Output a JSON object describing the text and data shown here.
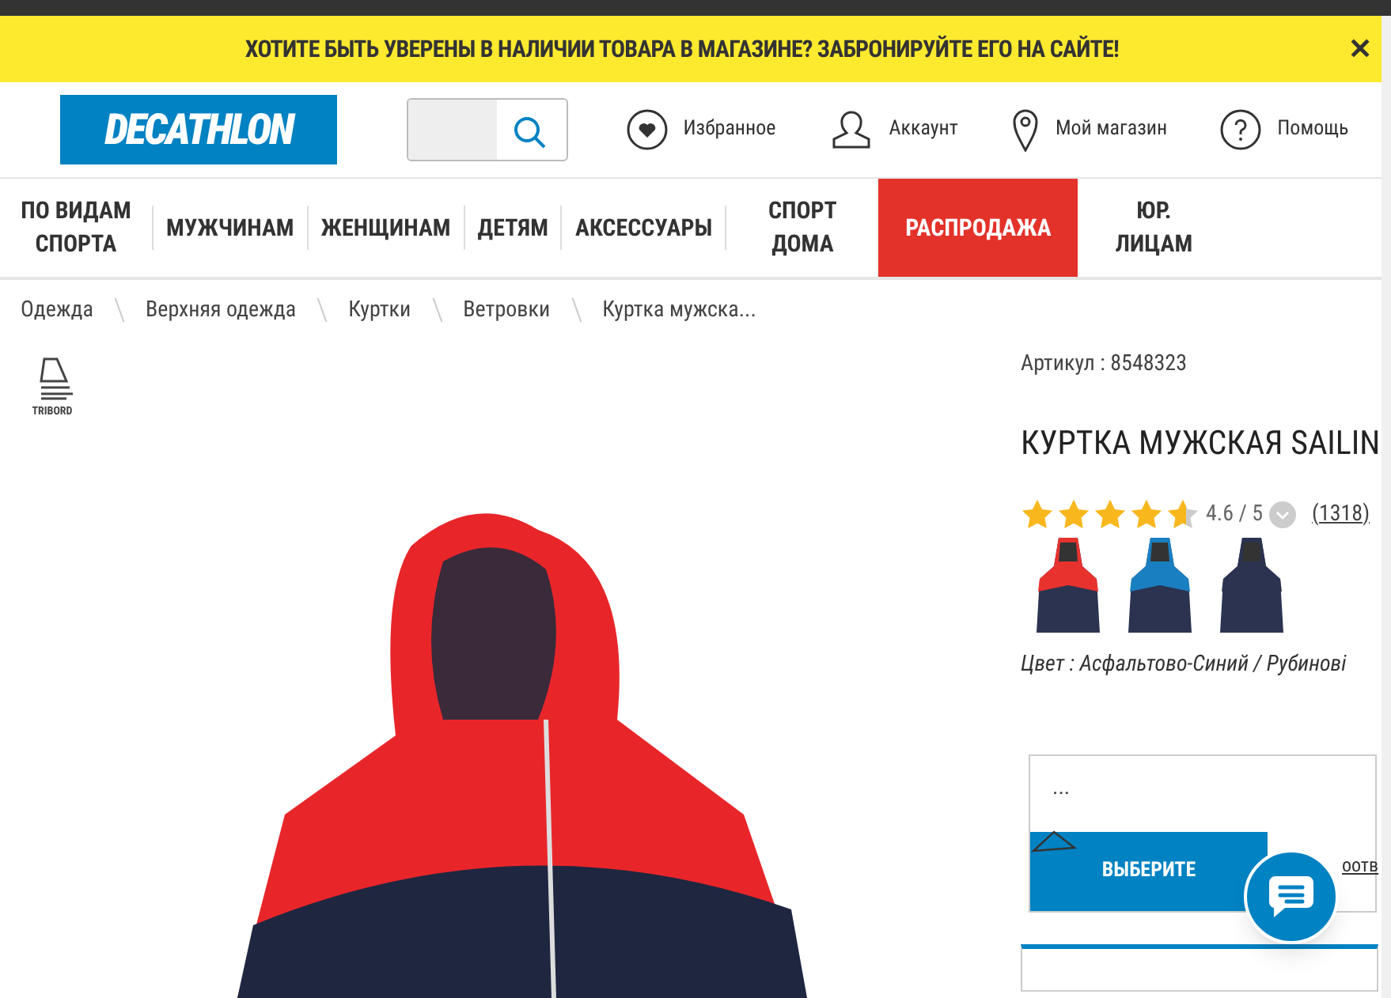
{
  "banner": {
    "text": "ХОТИТЕ БЫТЬ УВЕРЕНЫ В НАЛИЧИИ ТОВАРА В МАГАЗИНЕ? ЗАБРОНИРУЙТЕ ЕГО НА САЙТЕ!",
    "close": "✕"
  },
  "header": {
    "logo": "DECATHLON",
    "links": [
      {
        "kind": "heart",
        "label": "Избранное"
      },
      {
        "kind": "person",
        "label": "Аккаунт"
      },
      {
        "kind": "pin",
        "label": "Мой магазин"
      },
      {
        "kind": "help",
        "label": "Помощь"
      }
    ]
  },
  "nav": [
    {
      "label": "ПО ВИДАМ СПОРТА",
      "kind": "normal"
    },
    {
      "label": "МУЖЧИНАМ",
      "kind": "normal"
    },
    {
      "label": "ЖЕНЩИНАМ",
      "kind": "normal"
    },
    {
      "label": "ДЕТЯМ",
      "kind": "normal"
    },
    {
      "label": "АКСЕССУАРЫ",
      "kind": "normal"
    },
    {
      "label": "СПОРТ ДОМА",
      "kind": "normal"
    },
    {
      "label": "РАСПРОДАЖА",
      "kind": "sale"
    },
    {
      "label": "ЮР. ЛИЦАМ",
      "kind": "normal"
    }
  ],
  "breadcrumbs": [
    "Одежда",
    "Верхняя одежда",
    "Куртки",
    "Ветровки",
    "Куртка мужска..."
  ],
  "brand": {
    "name": "TRIBORD"
  },
  "product": {
    "article": "Артикул : 8548323",
    "title": "КУРТКА МУЖСКАЯ SAILIN",
    "stars": 4.6,
    "rating": "4.6 / 5",
    "reviews": "(1318)",
    "variants": [
      {
        "color": "#e8322e"
      },
      {
        "color": "#1a7fc0"
      },
      {
        "color": "#2b3350"
      }
    ],
    "color_label": "Цвет : Асфальтово-Синий / Рубинові",
    "size_value": "...",
    "select_button": "ВЫБЕРИТЕ",
    "size_link": "оотв"
  }
}
